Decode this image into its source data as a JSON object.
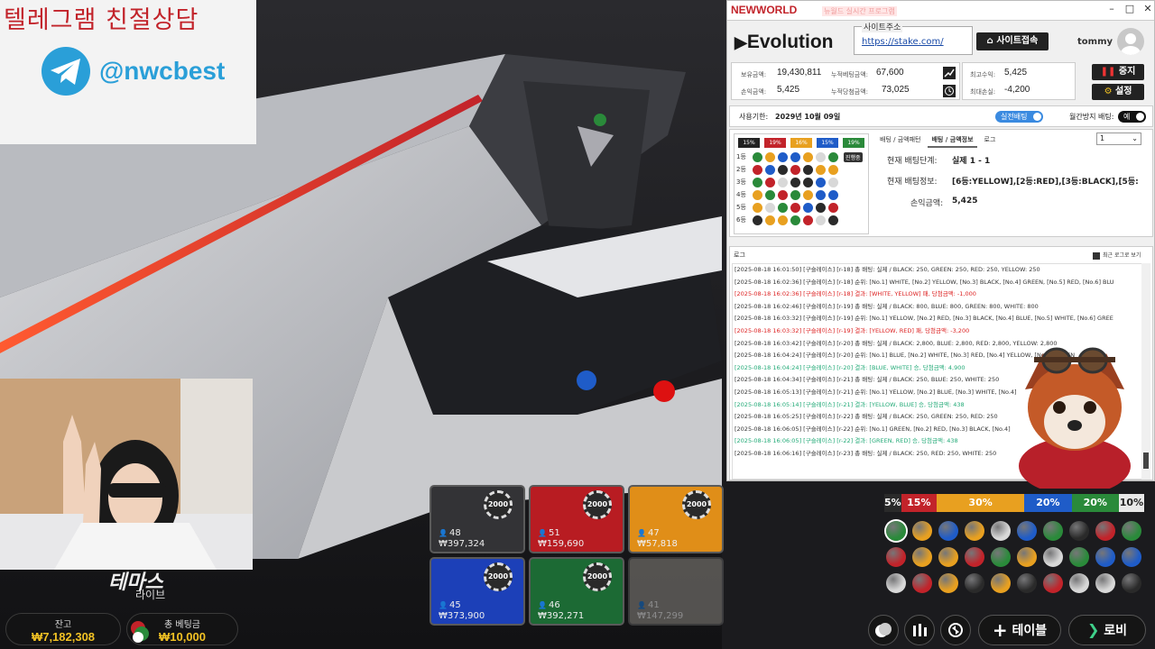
{
  "promo": {
    "title": "텔레그램 친절상담",
    "handle": "@nwcbest"
  },
  "game": {
    "logo": "테마스",
    "logo_sub": "라이브",
    "balance_label": "잔고",
    "balance_value": "₩7,182,308",
    "total_bet_label": "총 베팅금",
    "total_bet_value": "₩10,000"
  },
  "tiles": [
    {
      "color": "black",
      "chip": "2000",
      "count": "48",
      "amount": "₩397,324"
    },
    {
      "color": "red",
      "chip": "2000",
      "count": "51",
      "amount": "₩159,690"
    },
    {
      "color": "yellow",
      "chip": "2000",
      "count": "47",
      "amount": "₩57,818"
    },
    {
      "color": "blue",
      "chip": "2000",
      "count": "45",
      "amount": "₩373,900"
    },
    {
      "color": "green",
      "chip": "2000",
      "count": "46",
      "amount": "₩392,271"
    },
    {
      "color": "white",
      "chip": "",
      "count": "41",
      "amount": "₩147,299"
    }
  ],
  "percentages": [
    {
      "label": "5%",
      "color": "#2a2a2a"
    },
    {
      "label": "15%",
      "color": "#c2232a"
    },
    {
      "label": "30%",
      "color": "#e8a020"
    },
    {
      "label": "20%",
      "color": "#1f5cc8"
    },
    {
      "label": "20%",
      "color": "#2a8a3a"
    },
    {
      "label": "10%",
      "color": "#e8e8e8"
    }
  ],
  "ball_rows": [
    [
      "green",
      "yellow",
      "blue",
      "yellow",
      "white",
      "blue",
      "green",
      "black",
      "red",
      "green"
    ],
    [
      "red",
      "yellow",
      "yellow",
      "red",
      "green",
      "yellow",
      "white",
      "green",
      "blue",
      "blue"
    ],
    [
      "white",
      "red",
      "yellow",
      "black",
      "yellow",
      "black",
      "red",
      "white",
      "white",
      "black"
    ]
  ],
  "controls": {
    "table_label": "테이블",
    "lobby_label": "로비"
  },
  "app": {
    "logo": "NEWWORLD",
    "logo_sub": "뉴월드 실시간 프로그램",
    "provider": "Evolution",
    "site_label": "사이트주소",
    "site_url": "https://stake.com/",
    "site_button": "사이트접속",
    "user": "tommy",
    "stats": {
      "hold_label": "보유금액:",
      "hold_value": "19,430,811",
      "bet_total_label": "누적베팅금액:",
      "bet_total_value": "67,600",
      "pnl_label": "손익금액:",
      "pnl_value": "5,425",
      "win_total_label": "누적당첨금액:",
      "win_total_value": "73,025",
      "max_profit_label": "최고수익:",
      "max_profit_value": "5,425",
      "max_loss_label": "최대손실:",
      "max_loss_value": "-4,200"
    },
    "stop_button": "중지",
    "settings_button": "설정",
    "period_label": "사용기한:",
    "period_value": "2029년 10월 09일",
    "live_toggle": "실전배팅",
    "martingale_label": "월간방지 배팅:",
    "martingale_toggle": "예",
    "mini_percents": [
      "15%",
      "19%",
      "16%",
      "15%",
      "19%"
    ],
    "mini_rows": [
      "1등",
      "2등",
      "3등",
      "4등",
      "5등",
      "6등"
    ],
    "confirm_badge": "진행중",
    "tabs": [
      "배팅 / 금액패턴",
      "배팅 / 금액정보",
      "로그"
    ],
    "dropdown": "1",
    "current_step_label": "현재 배팅단계:",
    "current_step_value": "실제 1 - 1",
    "current_info_label": "현재 배팅정보:",
    "current_info_value": "[6등:YELLOW],[2등:RED],[3등:BLACK],[5등:",
    "pnl2_label": "손익금액:",
    "pnl2_value": "5,425",
    "log_title": "로그",
    "log_check_label": "최근 로그로 보기",
    "logs": [
      {
        "t": "[2025-08-18 16:01:50] [구슬레이스] [r-18] 총 배팅: 실제  / BLACK: 250, GREEN: 250, RED: 250, YELLOW: 250",
        "c": ""
      },
      {
        "t": "[2025-08-18 16:02:36] [구슬레이스] [r-18] 순위: [No.1] WHITE, [No.2] YELLOW, [No.3] BLACK, [No.4] GREEN, [No.5] RED, [No.6] BLU",
        "c": ""
      },
      {
        "t": "[2025-08-18 16:02:36] [구슬레이스] [r-18] 결과: [WHITE, YELLOW] 패, 당첨금액: -1,000",
        "c": "red"
      },
      {
        "t": "[2025-08-18 16:02:46] [구슬레이스] [r-19] 총 배팅: 실제  / BLACK: 800, BLUE: 800, GREEN: 800, WHITE: 800",
        "c": ""
      },
      {
        "t": "[2025-08-18 16:03:32] [구슬레이스] [r-19] 순위: [No.1] YELLOW, [No.2] RED, [No.3] BLACK, [No.4] BLUE, [No.5] WHITE, [No.6] GREE",
        "c": ""
      },
      {
        "t": "[2025-08-18 16:03:32] [구슬레이스] [r-19] 결과: [YELLOW, RED] 패, 당첨금액: -3,200",
        "c": "red"
      },
      {
        "t": "[2025-08-18 16:03:42] [구슬레이스] [r-20] 총 배팅: 실제  / BLACK: 2,800, BLUE: 2,800, RED: 2,800, YELLOW: 2,800",
        "c": ""
      },
      {
        "t": "[2025-08-18 16:04:24] [구슬레이스] [r-20] 순위: [No.1] BLUE, [No.2] WHITE, [No.3] RED, [No.4] YELLOW, [No.5] GREEN",
        "c": ""
      },
      {
        "t": "[2025-08-18 16:04:24] [구슬레이스] [r-20] 결과: [BLUE, WHITE] 승, 당첨금액: 4,900",
        "c": "green"
      },
      {
        "t": "[2025-08-18 16:04:34] [구슬레이스] [r-21] 총 배팅: 실제  / BLACK: 250, BLUE: 250, WHITE: 250",
        "c": ""
      },
      {
        "t": "[2025-08-18 16:05:13] [구슬레이스] [r-21] 순위: [No.1] YELLOW, [No.2] BLUE, [No.3] WHITE, [No.4]",
        "c": ""
      },
      {
        "t": "[2025-08-18 16:05:14] [구슬레이스] [r-21] 결과: [YELLOW, BLUE] 승, 당첨금액: 438",
        "c": "green"
      },
      {
        "t": "[2025-08-18 16:05:25] [구슬레이스] [r-22] 총 배팅: 실제  / BLACK: 250, GREEN: 250, RED: 250",
        "c": ""
      },
      {
        "t": "[2025-08-18 16:06:05] [구슬레이스] [r-22] 순위: [No.1] GREEN, [No.2] RED, [No.3] BLACK, [No.4]",
        "c": ""
      },
      {
        "t": "[2025-08-18 16:06:05] [구슬레이스] [r-22] 결과: [GREEN, RED] 승, 당첨금액: 438",
        "c": "green"
      },
      {
        "t": "[2025-08-18 16:06:16] [구슬레이스] [r-23] 총 배팅: 실제  / BLACK: 250, RED: 250, WHITE: 250",
        "c": ""
      }
    ]
  },
  "colors": {
    "red": "#c2232a",
    "yellow": "#e8a020",
    "blue": "#1f5cc8",
    "green": "#2a8a3a",
    "black": "#2a2a2a",
    "white": "#d8d8d8"
  }
}
